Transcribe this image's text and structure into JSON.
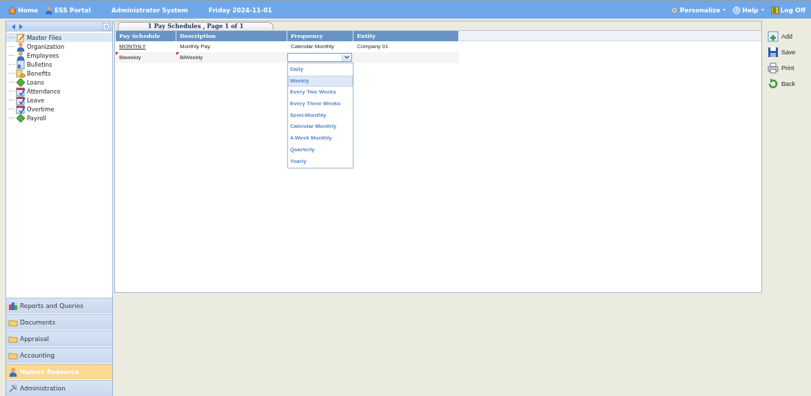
{
  "top_bar": {
    "links": [
      {
        "label": "Home",
        "kind": "home"
      },
      {
        "label": "ESS Portal",
        "kind": "person"
      }
    ],
    "system": "Administrator System",
    "date": "Friday 2024-11-01",
    "menus": [
      {
        "label": "Personalize",
        "kind": "gear",
        "dropdown": true
      },
      {
        "label": "Help",
        "kind": "help",
        "dropdown": true
      },
      {
        "label": "Log Off",
        "kind": "door",
        "dropdown": false
      }
    ]
  },
  "sidebar": {
    "tree": [
      {
        "label": "Master Files",
        "kind": "note",
        "selected": true
      },
      {
        "label": "Organization",
        "kind": "person",
        "selected": false
      },
      {
        "label": "Employees",
        "kind": "person",
        "selected": false
      },
      {
        "label": "Bulletins",
        "kind": "board",
        "selected": false
      },
      {
        "label": "Benefits",
        "kind": "coins",
        "selected": false
      },
      {
        "label": "Loans",
        "kind": "money",
        "selected": false
      },
      {
        "label": "Attendance",
        "kind": "calendar",
        "selected": false
      },
      {
        "label": "Leave",
        "kind": "calendar",
        "selected": false
      },
      {
        "label": "Overtime",
        "kind": "calendar",
        "selected": false
      },
      {
        "label": "Payroll",
        "kind": "money",
        "selected": false
      }
    ],
    "sections": [
      {
        "label": "Reports and Queries",
        "kind": "chart",
        "selected": false
      },
      {
        "label": "Documents",
        "kind": "folder",
        "selected": false
      },
      {
        "label": "Appraisal",
        "kind": "folder",
        "selected": false
      },
      {
        "label": "Accounting",
        "kind": "folder",
        "selected": false
      },
      {
        "label": "Human Resource",
        "kind": "person",
        "selected": true
      },
      {
        "label": "Administration",
        "kind": "tools",
        "selected": false
      }
    ]
  },
  "tab": {
    "title": "1 Pay Schedules , Page 1 of 1"
  },
  "table": {
    "columns": [
      "Pay Schedule",
      "Description",
      "Frequency",
      "Entity"
    ],
    "rows": [
      {
        "pay_schedule": "MONTHLY",
        "description": "Monthly Pay",
        "frequency": "Calendar Monthly",
        "entity": "Company 01",
        "modified": false,
        "editing": false
      },
      {
        "pay_schedule": "Biweekly",
        "description": "BiWeekly",
        "modified": true,
        "editing": true
      }
    ]
  },
  "dropdown": {
    "options": [
      {
        "label": "Daily",
        "selected": false
      },
      {
        "label": "Weekly",
        "selected": true
      },
      {
        "label": "Every Two Weeks",
        "selected": false
      },
      {
        "label": "Every Three Weeks",
        "selected": false
      },
      {
        "label": "Semi-Monthly",
        "selected": false
      },
      {
        "label": "Calendar Monthly",
        "selected": false
      },
      {
        "label": "4-Week Monthly",
        "selected": false
      },
      {
        "label": "Quarterly",
        "selected": false
      },
      {
        "label": "Yearly",
        "selected": false
      }
    ]
  },
  "actions": [
    {
      "label": "Add",
      "kind": "add"
    },
    {
      "label": "Save",
      "kind": "save"
    },
    {
      "label": "Print",
      "kind": "print"
    },
    {
      "label": "Back",
      "kind": "back"
    }
  ]
}
